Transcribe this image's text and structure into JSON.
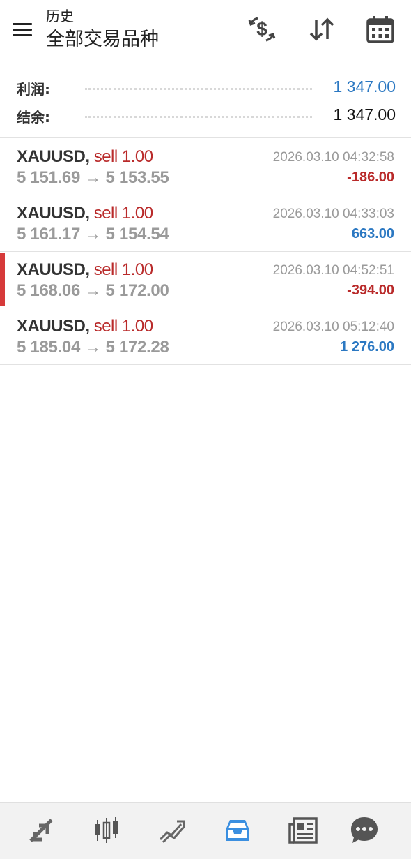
{
  "header": {
    "title_small": "历史",
    "title_big": "全部交易品种",
    "icons": [
      "menu-icon",
      "currency-exchange-icon",
      "sort-icon",
      "calendar-icon"
    ]
  },
  "summary": {
    "profit_label": "利润:",
    "profit_value": "1 347.00",
    "balance_label": "结余:",
    "balance_value": "1 347.00"
  },
  "trades": [
    {
      "symbol": "XAUUSD",
      "side": "sell 1.00",
      "open": "5 151.69",
      "arrow": "→",
      "close": "5 153.55",
      "time": "2026.03.10 04:32:58",
      "profit": "-186.00"
    },
    {
      "symbol": "XAUUSD",
      "side": "sell 1.00",
      "open": "5 161.17",
      "arrow": "→",
      "close": "5 154.54",
      "time": "2026.03.10 04:33:03",
      "profit": "663.00"
    },
    {
      "symbol": "XAUUSD",
      "side": "sell 1.00",
      "open": "5 168.06",
      "arrow": "→",
      "close": "5 172.00",
      "time": "2026.03.10 04:52:51",
      "profit": "-394.00"
    },
    {
      "symbol": "XAUUSD",
      "side": "sell 1.00",
      "open": "5 185.04",
      "arrow": "→",
      "close": "5 172.28",
      "time": "2026.03.10 05:12:40",
      "profit": "1 276.00"
    }
  ],
  "colors": {
    "positive": "#2b78c2",
    "negative": "#b92a2a",
    "selected_marker": "#d63a3a",
    "active_tab": "#3b8fe0"
  },
  "bottom_tabs": [
    "quotes-icon",
    "chart-candles-icon",
    "trade-icon",
    "history-inbox-icon",
    "news-icon",
    "chat-icon"
  ]
}
